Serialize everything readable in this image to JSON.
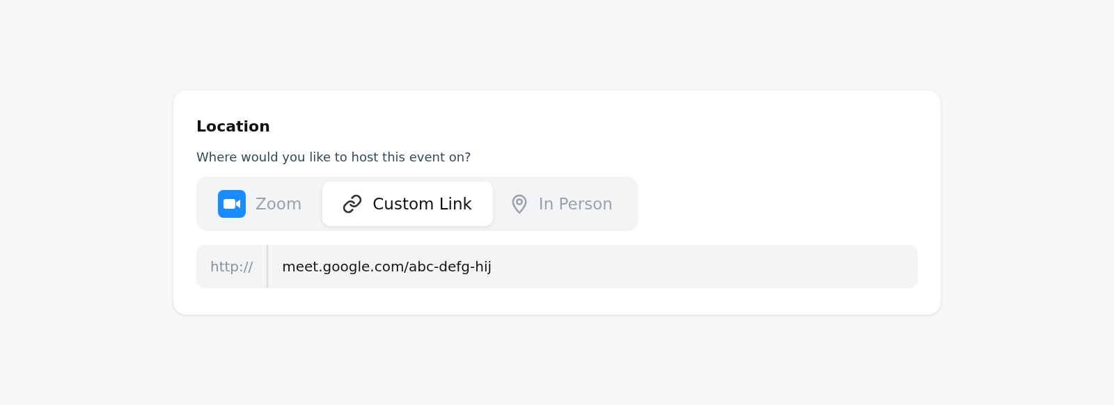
{
  "section": {
    "title": "Location",
    "subtitle": "Where would you like to host this event on?"
  },
  "tabs": [
    {
      "kind": "video",
      "label": "Zoom",
      "selected": false
    },
    {
      "kind": "link",
      "label": "Custom Link",
      "selected": true
    },
    {
      "kind": "place",
      "label": "In Person",
      "selected": false
    }
  ],
  "url_field": {
    "prefix": "http://",
    "value": "meet.google.com/abc-defg-hij"
  }
}
